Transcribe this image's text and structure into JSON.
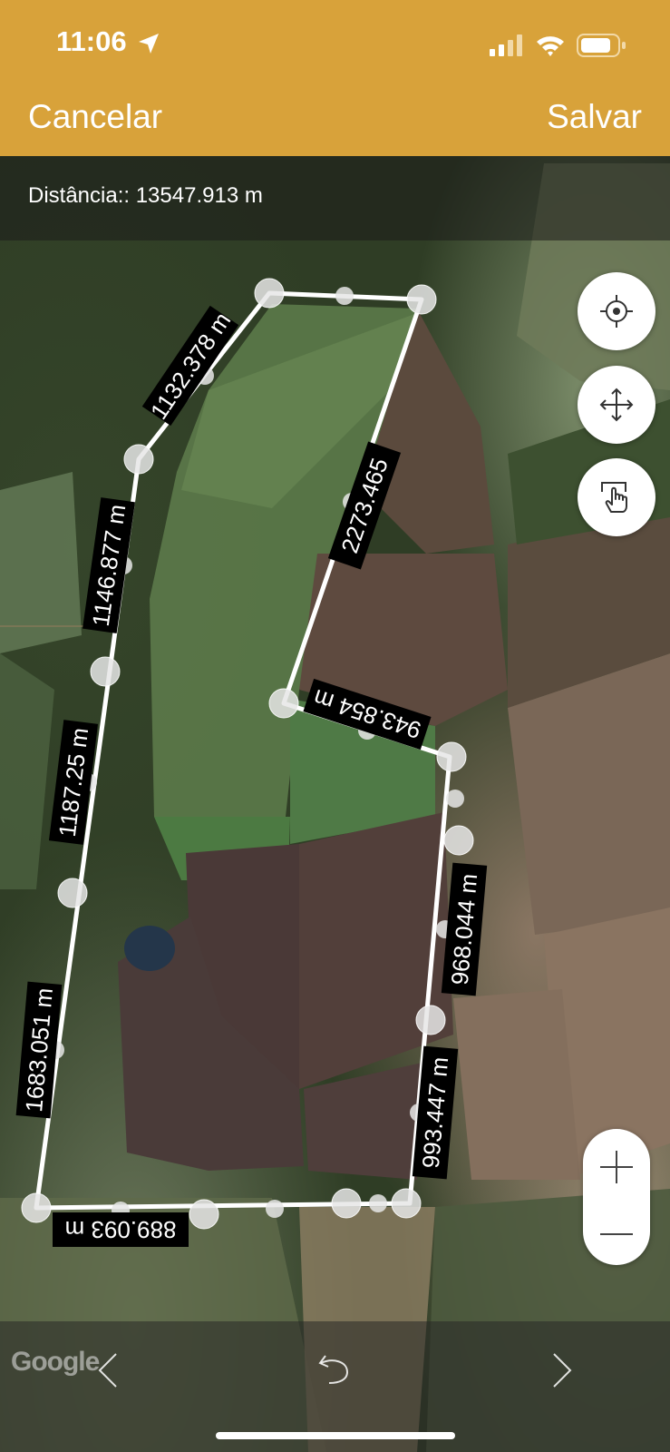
{
  "status_bar": {
    "time": "11:06"
  },
  "nav": {
    "cancel_label": "Cancelar",
    "save_label": "Salvar"
  },
  "distance": {
    "text": "Distância:: 13547.913 m"
  },
  "segments": [
    "1132.378 m",
    "2273.465",
    "1146.877 m",
    "943.854 m",
    "1187.25 m",
    "968.044 m",
    "1683.051 m",
    "993.447 m",
    "889.093 m"
  ],
  "controls": {
    "zoom_in": "+",
    "zoom_out": "—",
    "icons": [
      "location-target-icon",
      "move-arrows-icon",
      "touch-hand-icon",
      "undo-icon",
      "chevron-left-icon",
      "chevron-right-icon"
    ]
  },
  "map_attribution": "Google"
}
